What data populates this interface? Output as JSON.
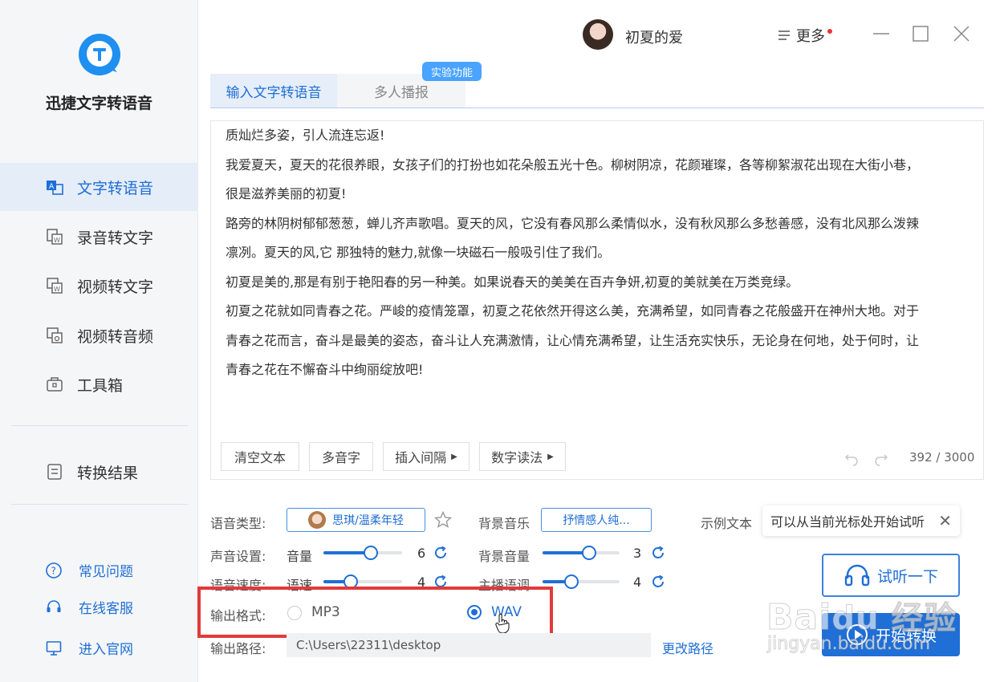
{
  "app": {
    "brand": "迅捷文字转语音"
  },
  "sidebar": {
    "items": [
      {
        "label": "文字转语音",
        "icon": "text-to-speech-icon",
        "active": true
      },
      {
        "label": "录音转文字",
        "icon": "recording-to-text-icon"
      },
      {
        "label": "视频转文字",
        "icon": "video-to-text-icon"
      },
      {
        "label": "视频转音频",
        "icon": "video-to-audio-icon"
      },
      {
        "label": "工具箱",
        "icon": "toolbox-icon"
      }
    ],
    "result": {
      "label": "转换结果",
      "icon": "result-icon"
    },
    "help": [
      {
        "label": "常见问题",
        "icon": "question-icon"
      },
      {
        "label": "在线客服",
        "icon": "headset-icon"
      },
      {
        "label": "进入官网",
        "icon": "monitor-icon"
      }
    ]
  },
  "header": {
    "username": "初夏的爱",
    "more": "更多"
  },
  "tabs": [
    {
      "label": "输入文字转语音"
    },
    {
      "label": "多人播报"
    }
  ],
  "badge": "实验功能",
  "editor": {
    "lines": [
      "质灿烂多姿，引人流连忘返!",
      "我爱夏天，夏天的花很养眼，女孩子们的打扮也如花朵般五光十色。柳树阴凉，花颜璀璨，各等柳絮淑花出现在大街小巷，",
      "很是滋养美丽的初夏!",
      "路旁的林阴树郁郁葱葱，蝉儿齐声歌唱。夏天的风，它没有春风那么柔情似水，没有秋风那么多愁善感，没有北风那么泼辣",
      "凛冽。夏天的风,它 那独特的魅力,就像一块磁石一般吸引住了我们。",
      "初夏是美的,那是有别于艳阳春的另一种美。如果说春天的美美在百卉争妍,初夏的美就美在万类竞绿。",
      "初夏之花就如同青春之花。严峻的疫情笼罩，初夏之花依然开得这么美，充满希望，如同青春之花般盛开在神州大地。对于",
      "青春之花而言，奋斗是最美的姿态，奋斗让人充满激情，让心情充满希望，让生活充实快乐，无论身在何地，处于何时，让",
      "青春之花在不懈奋斗中绚丽绽放吧!"
    ],
    "toolbar": {
      "clear": "清空文本",
      "polyphone": "多音字",
      "insert": "插入间隔",
      "number": "数字读法"
    },
    "count": "392 / 3000"
  },
  "settings": {
    "voice_type_label": "语音类型:",
    "voice": "思琪/温柔年轻",
    "bg_music_label": "背景音乐",
    "bg_music": "抒情感人纯...",
    "sample_label": "示例文本",
    "sample_text": "可以从当前光标处开始试听",
    "sound_label": "声音设置:",
    "volume_label": "音量",
    "volume": "6",
    "volume_level": 0.6,
    "bg_volume_label": "背景音量",
    "bg_volume": "3",
    "bg_volume_level": 0.6,
    "speed_label": "语音速度:",
    "rate_label": "语速",
    "rate": "4",
    "rate_level": 0.35,
    "pitch_label": "主播语调",
    "pitch": "4",
    "pitch_level": 0.38,
    "format_label": "输出格式:",
    "format_mp3": "MP3",
    "format_wav": "WAV",
    "path_label": "输出路径:",
    "path": "C:\\Users\\22311\\desktop",
    "change_path": "更改路径",
    "listen": "试听一下",
    "start": "开始转换"
  },
  "colors": {
    "accent": "#1f6fd6",
    "highlight": "#e23a3a",
    "sidebar_bg": "#f5f6f8"
  }
}
